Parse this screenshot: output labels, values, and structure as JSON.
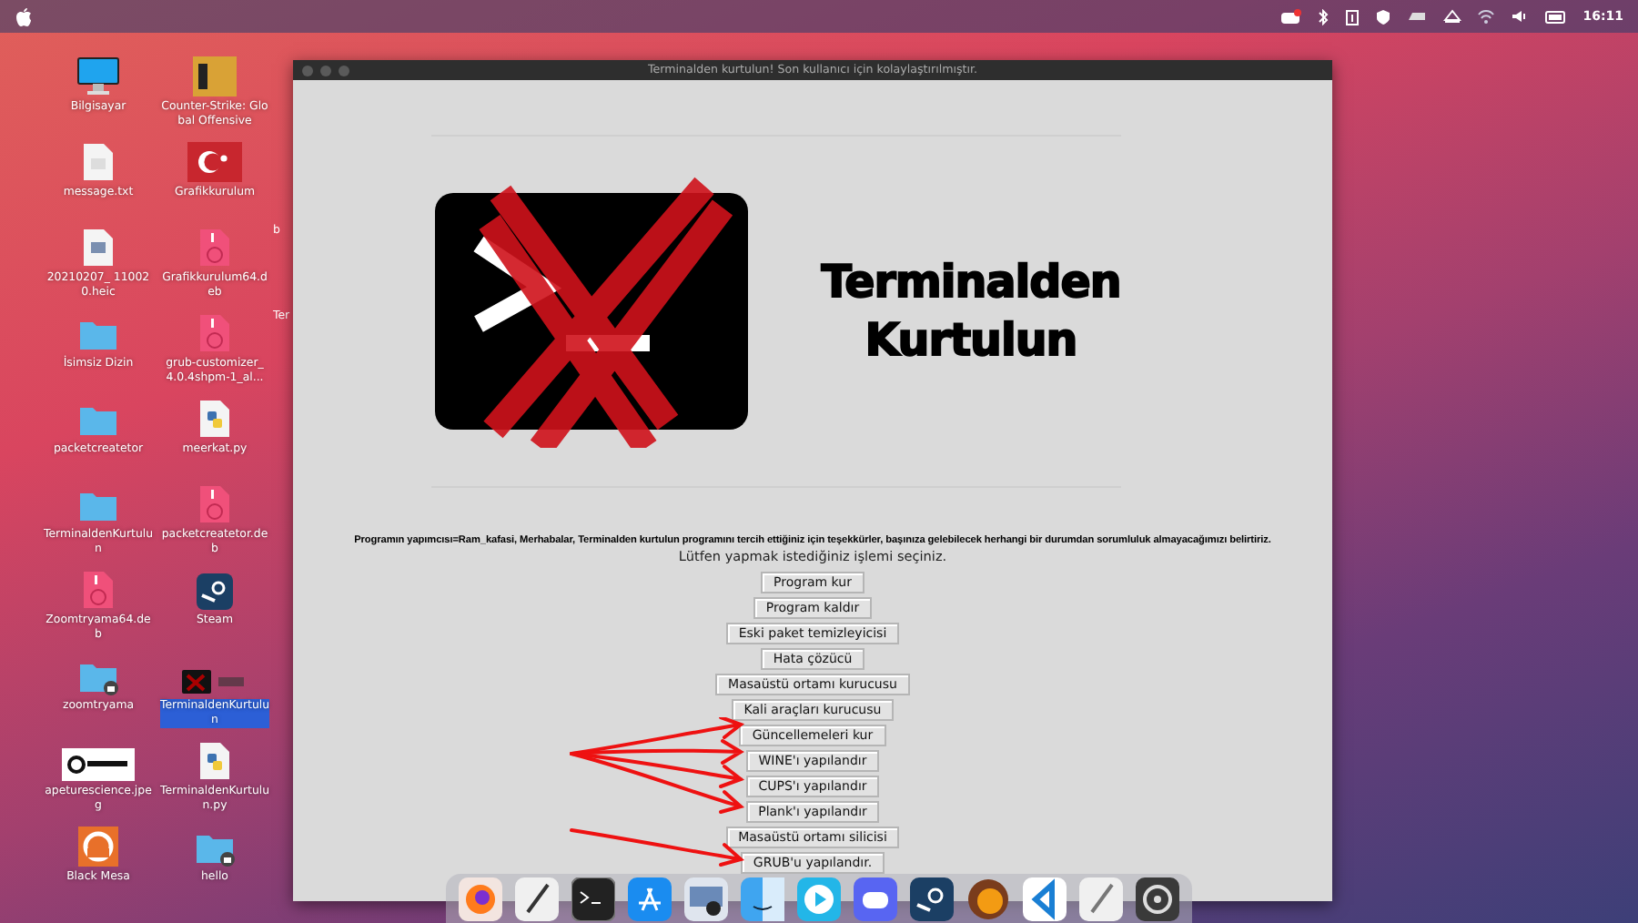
{
  "menubar": {
    "time": "16:11"
  },
  "desktop_icons": [
    {
      "label": "Bilgisayar",
      "kind": "computer",
      "selected": false
    },
    {
      "label": "Counter-Strike: Global Offensive",
      "kind": "game",
      "selected": false
    },
    {
      "label": "message.txt",
      "kind": "text",
      "selected": false
    },
    {
      "label": "Grafikkurulum",
      "kind": "flag",
      "selected": false
    },
    {
      "label": "20210207_ 110020.heic",
      "kind": "image",
      "selected": false
    },
    {
      "label": "Grafikkurulum64.deb",
      "kind": "deb",
      "selected": false
    },
    {
      "label": "İsimsiz Dizin",
      "kind": "folder",
      "selected": false
    },
    {
      "label": "grub-customizer_ 4.0.4shpm-1_al...",
      "kind": "deb",
      "selected": false
    },
    {
      "label": "packetcreatetor",
      "kind": "folder",
      "selected": false
    },
    {
      "label": "meerkat.py",
      "kind": "python",
      "selected": false
    },
    {
      "label": "TerminaldenKurtulun",
      "kind": "folder",
      "selected": false
    },
    {
      "label": "packetcreatetor.deb",
      "kind": "deb",
      "selected": false
    },
    {
      "label": "Zoomtryama64.deb",
      "kind": "deb",
      "selected": false
    },
    {
      "label": "Steam",
      "kind": "steam",
      "selected": false
    },
    {
      "label": "zoomtryama",
      "kind": "locked-folder",
      "selected": false
    },
    {
      "label": "TerminaldenKurtulun",
      "kind": "thumbnail",
      "selected": true
    },
    {
      "label": "apeturescience.jpeg",
      "kind": "photo",
      "selected": false
    },
    {
      "label": "TerminaldenKurtulun.py",
      "kind": "python",
      "selected": false
    },
    {
      "label": "Black Mesa",
      "kind": "orange-app",
      "selected": false
    },
    {
      "label": "hello",
      "kind": "locked-folder",
      "selected": false
    }
  ],
  "hidden_icon_labels": [
    "b",
    "Ter"
  ],
  "window": {
    "title": "Terminalden kurtulun! Son kullanıcı için kolaylaştırılmıştır.",
    "heading_lines": [
      "Terminalden",
      "Kurtulun"
    ],
    "notice": "Programın yapımcısı=Ram_kafasi, Merhabalar, Terminalden kurtulun programını tercih ettiğiniz için teşekkürler, başınıza gelebilecek herhangi bir durumdan sorumluluk almayacağımızı belirtiriz.",
    "prompt": "Lütfen yapmak istediğiniz işlemi seçiniz.",
    "buttons": [
      "Program kur",
      "Program kaldır",
      "Eski paket temizleyicisi",
      "Hata çözücü",
      "Masaüstü ortamı kurucusu",
      "Kali araçları kurucusu",
      "Güncellemeleri kur",
      "WINE'ı yapılandır",
      "CUPS'ı yapılandır",
      "Plank'ı yapılandır",
      "Masaüstü ortamı silicisi",
      "GRUB'u yapılandır."
    ]
  }
}
